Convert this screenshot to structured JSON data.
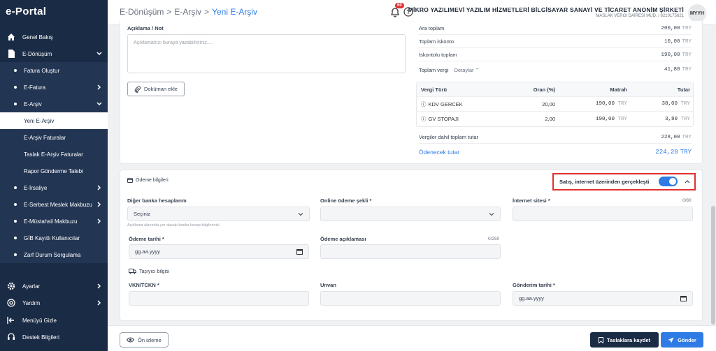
{
  "app": {
    "logo": "e-Portal"
  },
  "sidebar": {
    "items": [
      {
        "label": "Genel Bakış"
      },
      {
        "label": "E-Dönüşüm"
      },
      {
        "label": "Fatura Oluştur"
      },
      {
        "label": "E-Fatura"
      },
      {
        "label": "E-Arşiv"
      },
      {
        "label": "Yeni E-Arşiv"
      },
      {
        "label": "E-Arşiv Faturalar"
      },
      {
        "label": "Taslak E-Arşiv Faturalar"
      },
      {
        "label": "Rapor Gönderme Talebi"
      },
      {
        "label": "E-İrsaliye"
      },
      {
        "label": "E-Serbest Meslek Makbuzu"
      },
      {
        "label": "E-Müstahsil Makbuzu"
      },
      {
        "label": "GİB Kayıtlı Kullanıcılar"
      },
      {
        "label": "Zarf Durum Sorgulama"
      },
      {
        "label": "Ayarlar"
      },
      {
        "label": "Yardım"
      },
      {
        "label": "Menüyü Gizle"
      },
      {
        "label": "Destek Bilgileri"
      }
    ]
  },
  "header": {
    "breadcrumb": [
      "E-Dönüşüm",
      "E-Arşiv",
      "Yeni E-Arşiv"
    ],
    "sep": ">",
    "notification_count": "60",
    "company_name": "MİKRO YAZILIMEVİ YAZILIM HİZMETLERİ BİLGİSAYAR SANAYİ VE TİCARET ANONİM ŞİRKETİ",
    "company_sub": "MASLAK VERGİ DAİRESİ MÜD. / 6210175621",
    "avatar": "MYYH"
  },
  "note": {
    "label": "Açıklama / Not",
    "placeholder": "Açıklamanızı buraya yazabilirsiniz....",
    "doc_button": "Doküman ekle"
  },
  "totals": {
    "currency": "TRY",
    "rows": [
      {
        "label": "Ara toplam",
        "value": "200,00"
      },
      {
        "label": "Toplam iskonto",
        "value": "10,00"
      },
      {
        "label": "İskontolu toplam",
        "value": "190,00"
      },
      {
        "label": "Toplam vergi",
        "link": "Detaylar",
        "value": "41,80"
      }
    ],
    "tax_table": {
      "headers": [
        "Vergi Türü",
        "Oran (%)",
        "Matrah",
        "Tutar"
      ],
      "rows": [
        {
          "type": "KDV GERCEK",
          "rate": "20,00",
          "base": "190,00",
          "amount": "38,00"
        },
        {
          "type": "GV STOPAJI",
          "rate": "2,00",
          "base": "190,00",
          "amount": "3,80"
        }
      ]
    },
    "tax_incl_label": "Vergiler dahil toplam tutar",
    "tax_incl_value": "228,00",
    "payable_label": "Ödenecek tutar",
    "payable_value": "224,20"
  },
  "payment": {
    "section_title": "Ödeme bilgileri",
    "toggle_label": "Satış, internet üzerinden gerçekleşti",
    "toggle_on": true,
    "bank_label": "Diğer banka hesaplarım",
    "bank_value": "Seçiniz",
    "bank_hint": "Açıklama alanında yer alacak banka hesap bilgilerinizi",
    "online_label": "Online ödeme şekli *",
    "site_label": "İnternet sitesi *",
    "site_counter": "0/80",
    "date_label": "Ödeme tarihi *",
    "date_placeholder": "gg.aa.yyyy",
    "desc_label": "Ödeme açıklaması",
    "desc_counter": "0/250"
  },
  "carrier": {
    "title": "Taşıyıcı bilgisi",
    "vkn_label": "VKN/TCKN *",
    "unvan_label": "Unvan",
    "ship_date_label": "Gönderim tarihi *",
    "ship_date_placeholder": "gg.aa.yyyy"
  },
  "footer": {
    "preview": "Ön izleme",
    "save_draft": "Taslaklara kaydet",
    "send": "Gönder"
  },
  "colors": {
    "accent": "#2f7be5",
    "sidebar": "#1a2b45",
    "highlight": "#e03131"
  }
}
